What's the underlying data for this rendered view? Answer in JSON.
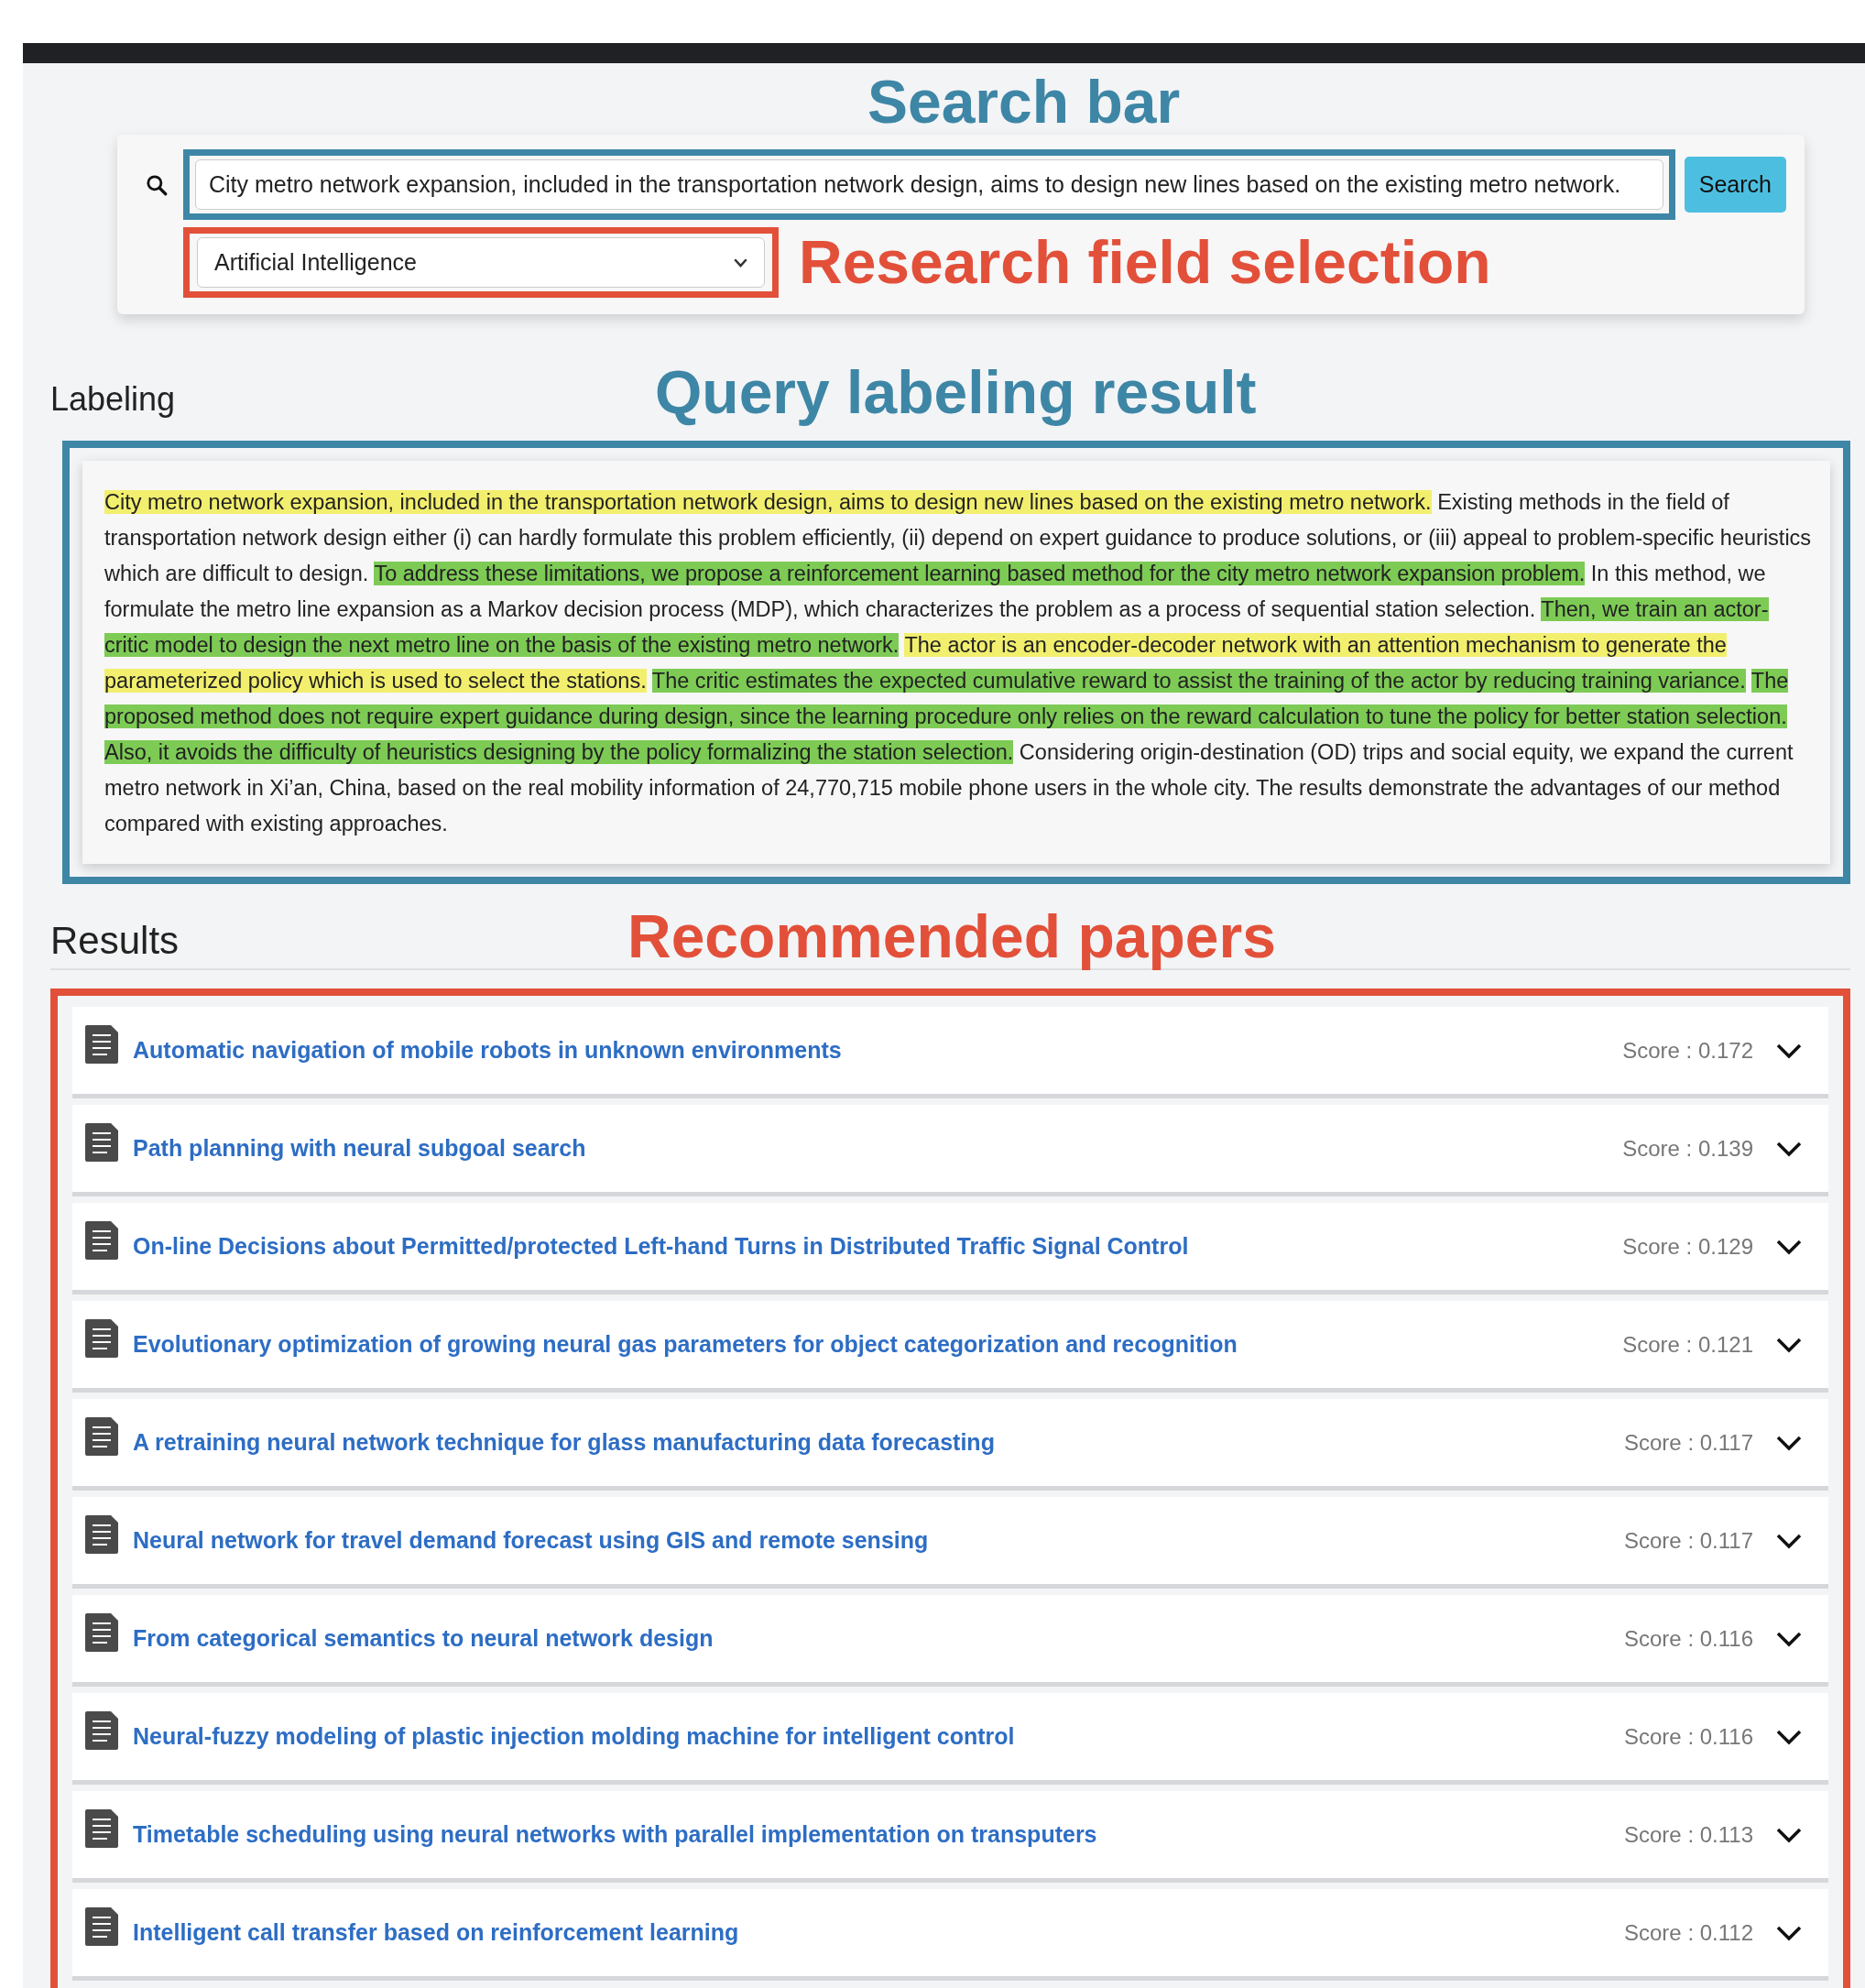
{
  "search_bar": {
    "annotation": {
      "text": "Search bar",
      "color": "#3e86a6"
    },
    "query": "City metro network expansion, included in the transportation network design, aims to design new lines based on the existing metro network.",
    "button": "Search"
  },
  "field_selection": {
    "annotation": {
      "text": "Research field selection",
      "color": "#e2503a"
    },
    "value": "Artificial Intelligence"
  },
  "labeling": {
    "heading": "Labeling",
    "annotation": {
      "text": "Query labeling result",
      "color": "#3e86a6"
    },
    "segments": [
      {
        "text": "City metro network expansion, included in the transportation network design, aims to design new lines based on the existing metro network.",
        "color": "#f2ef6e"
      },
      {
        "text": "Existing methods in the field of transportation network design either (i) can hardly formulate this problem efficiently, (ii) depend on expert guidance to produce solutions, or (iii) appeal to problem-specific heuristics which are difficult to design."
      },
      {
        "text": "To address these limitations, we propose a reinforcement learning based method for the city metro network expansion problem.",
        "color": "#7dcb55"
      },
      {
        "text": "In this method, we formulate the metro line expansion as a Markov decision process (MDP), which characterizes the problem as a process of sequential station selection."
      },
      {
        "text": "Then, we train an actor-critic model to design the next metro line on the basis of the existing metro network.",
        "color": "#7dcb55"
      },
      {
        "text": "The actor is an encoder-decoder network with an attention mechanism to generate the parameterized policy which is used to select the stations.",
        "color": "#f2ef6e"
      },
      {
        "text": "The critic estimates the expected cumulative reward to assist the training of the actor by reducing training variance.",
        "color": "#7dcb55"
      },
      {
        "text": "The proposed method does not require expert guidance during design, since the learning procedure only relies on the reward calculation to tune the policy for better station selection.",
        "color": "#7dcb55"
      },
      {
        "text": "Also, it avoids the difficulty of heuristics designing by the policy formalizing the station selection.",
        "color": "#7dcb55"
      },
      {
        "text": "Considering origin-destination (OD) trips and social equity, we expand the current metro network in Xi’an, China, based on the real mobility information of 24,770,715 mobile phone users in the whole city. The results demonstrate the advantages of our method compared with existing approaches."
      }
    ]
  },
  "results": {
    "heading": "Results",
    "annotation": {
      "text": "Recommended papers",
      "color": "#e2503a"
    },
    "papers": [
      {
        "title": "Automatic navigation of mobile robots in unknown environments",
        "score": "Score : 0.172"
      },
      {
        "title": "Path planning with neural subgoal search",
        "score": "Score : 0.139"
      },
      {
        "title": "On-line Decisions about Permitted/protected Left-hand Turns in Distributed Traffic Signal Control",
        "score": "Score : 0.129"
      },
      {
        "title": "Evolutionary optimization of growing neural gas parameters for object categorization and recognition",
        "score": "Score : 0.121"
      },
      {
        "title": "A retraining neural network technique for glass manufacturing data forecasting",
        "score": "Score : 0.117"
      },
      {
        "title": "Neural network for travel demand forecast using GIS and remote sensing",
        "score": "Score : 0.117"
      },
      {
        "title": "From categorical semantics to neural network design",
        "score": "Score : 0.116"
      },
      {
        "title": "Neural-fuzzy modeling of plastic injection molding machine for intelligent control",
        "score": "Score : 0.116"
      },
      {
        "title": "Timetable scheduling using neural networks with parallel implementation on transputers",
        "score": "Score : 0.113"
      },
      {
        "title": "Intelligent call transfer based on reinforcement learning",
        "score": "Score : 0.112"
      }
    ]
  }
}
